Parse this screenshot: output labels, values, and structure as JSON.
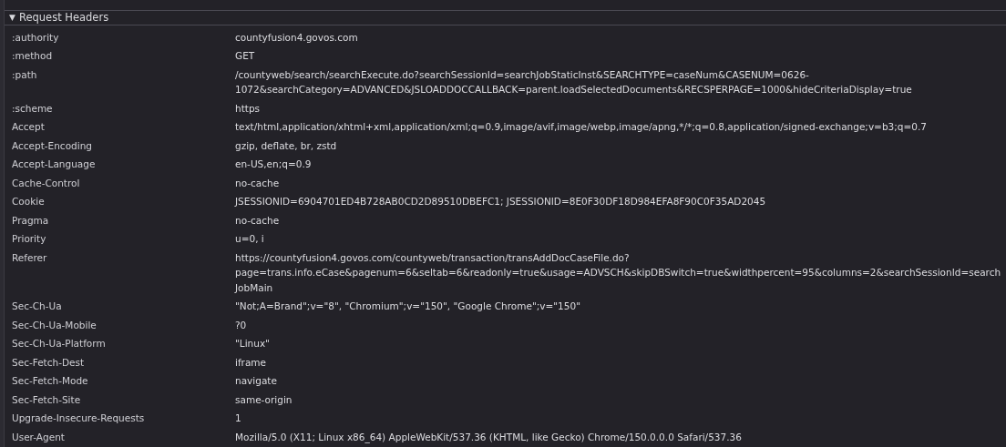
{
  "section": {
    "toggle": "▼",
    "title": "Request Headers"
  },
  "headers": [
    {
      "name": ":authority",
      "value": "countyfusion4.govos.com"
    },
    {
      "name": ":method",
      "value": "GET"
    },
    {
      "name": ":path",
      "value": "/countyweb/search/searchExecute.do?searchSessionId=searchJobStaticInst&SEARCHTYPE=caseNum&CASENUM=0626-1072&searchCategory=ADVANCED&JSLOADDOCCALLBACK=parent.loadSelectedDocuments&RECSPERPAGE=1000&hideCriteriaDisplay=true"
    },
    {
      "name": ":scheme",
      "value": "https"
    },
    {
      "name": "Accept",
      "value": "text/html,application/xhtml+xml,application/xml;q=0.9,image/avif,image/webp,image/apng,*/*;q=0.8,application/signed-exchange;v=b3;q=0.7"
    },
    {
      "name": "Accept-Encoding",
      "value": "gzip, deflate, br, zstd"
    },
    {
      "name": "Accept-Language",
      "value": "en-US,en;q=0.9"
    },
    {
      "name": "Cache-Control",
      "value": "no-cache"
    },
    {
      "name": "Cookie",
      "value": "JSESSIONID=6904701ED4B728AB0CD2D89510DBEFC1; JSESSIONID=8E0F30DF18D984EFA8F90C0F35AD2045"
    },
    {
      "name": "Pragma",
      "value": "no-cache"
    },
    {
      "name": "Priority",
      "value": "u=0, i"
    },
    {
      "name": "Referer",
      "value": "https://countyfusion4.govos.com/countyweb/transaction/transAddDocCaseFile.do?page=trans.info.eCase&pagenum=6&seltab=6&readonly=true&usage=ADVSCH&skipDBSwitch=true&widthpercent=95&columns=2&searchSessionId=searchJobMain"
    },
    {
      "name": "Sec-Ch-Ua",
      "value": "\"Not;A=Brand\";v=\"8\", \"Chromium\";v=\"150\", \"Google Chrome\";v=\"150\""
    },
    {
      "name": "Sec-Ch-Ua-Mobile",
      "value": "?0"
    },
    {
      "name": "Sec-Ch-Ua-Platform",
      "value": "\"Linux\""
    },
    {
      "name": "Sec-Fetch-Dest",
      "value": "iframe"
    },
    {
      "name": "Sec-Fetch-Mode",
      "value": "navigate"
    },
    {
      "name": "Sec-Fetch-Site",
      "value": "same-origin"
    },
    {
      "name": "Upgrade-Insecure-Requests",
      "value": "1"
    },
    {
      "name": "User-Agent",
      "value": "Mozilla/5.0 (X11; Linux x86_64) AppleWebKit/537.36 (KHTML, like Gecko) Chrome/150.0.0.0 Safari/537.36"
    }
  ]
}
